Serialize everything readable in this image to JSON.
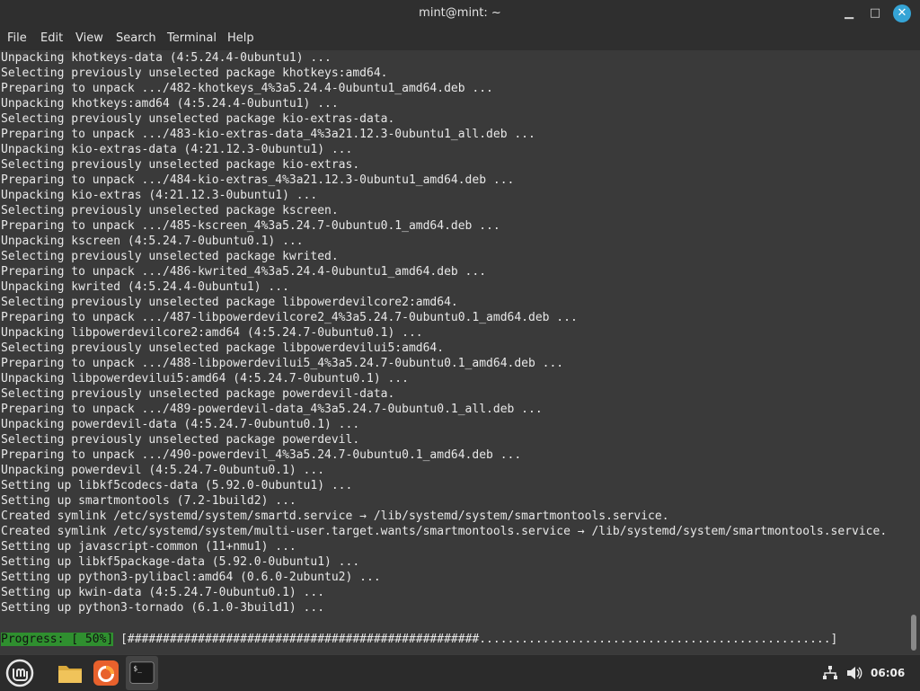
{
  "window": {
    "title": "mint@mint: ~"
  },
  "menu": [
    "File",
    "Edit",
    "View",
    "Search",
    "Terminal",
    "Help"
  ],
  "terminal": {
    "lines": [
      "Unpacking khotkeys-data (4:5.24.4-0ubuntu1) ...",
      "Selecting previously unselected package khotkeys:amd64.",
      "Preparing to unpack .../482-khotkeys_4%3a5.24.4-0ubuntu1_amd64.deb ...",
      "Unpacking khotkeys:amd64 (4:5.24.4-0ubuntu1) ...",
      "Selecting previously unselected package kio-extras-data.",
      "Preparing to unpack .../483-kio-extras-data_4%3a21.12.3-0ubuntu1_all.deb ...",
      "Unpacking kio-extras-data (4:21.12.3-0ubuntu1) ...",
      "Selecting previously unselected package kio-extras.",
      "Preparing to unpack .../484-kio-extras_4%3a21.12.3-0ubuntu1_amd64.deb ...",
      "Unpacking kio-extras (4:21.12.3-0ubuntu1) ...",
      "Selecting previously unselected package kscreen.",
      "Preparing to unpack .../485-kscreen_4%3a5.24.7-0ubuntu0.1_amd64.deb ...",
      "Unpacking kscreen (4:5.24.7-0ubuntu0.1) ...",
      "Selecting previously unselected package kwrited.",
      "Preparing to unpack .../486-kwrited_4%3a5.24.4-0ubuntu1_amd64.deb ...",
      "Unpacking kwrited (4:5.24.4-0ubuntu1) ...",
      "Selecting previously unselected package libpowerdevilcore2:amd64.",
      "Preparing to unpack .../487-libpowerdevilcore2_4%3a5.24.7-0ubuntu0.1_amd64.deb ...",
      "Unpacking libpowerdevilcore2:amd64 (4:5.24.7-0ubuntu0.1) ...",
      "Selecting previously unselected package libpowerdevilui5:amd64.",
      "Preparing to unpack .../488-libpowerdevilui5_4%3a5.24.7-0ubuntu0.1_amd64.deb ...",
      "Unpacking libpowerdevilui5:amd64 (4:5.24.7-0ubuntu0.1) ...",
      "Selecting previously unselected package powerdevil-data.",
      "Preparing to unpack .../489-powerdevil-data_4%3a5.24.7-0ubuntu0.1_all.deb ...",
      "Unpacking powerdevil-data (4:5.24.7-0ubuntu0.1) ...",
      "Selecting previously unselected package powerdevil.",
      "Preparing to unpack .../490-powerdevil_4%3a5.24.7-0ubuntu0.1_amd64.deb ...",
      "Unpacking powerdevil (4:5.24.7-0ubuntu0.1) ...",
      "Setting up libkf5codecs-data (5.92.0-0ubuntu1) ...",
      "Setting up smartmontools (7.2-1build2) ...",
      "Created symlink /etc/systemd/system/smartd.service → /lib/systemd/system/smartmontools.service.",
      "Created symlink /etc/systemd/system/multi-user.target.wants/smartmontools.service → /lib/systemd/system/smartmontools.service.",
      "Setting up javascript-common (11+nmu1) ...",
      "Setting up libkf5package-data (5.92.0-0ubuntu1) ...",
      "Setting up python3-pylibacl:amd64 (0.6.0-2ubuntu2) ...",
      "Setting up kwin-data (4:5.24.7-0ubuntu0.1) ...",
      "Setting up python3-tornado (6.1.0-3build1) ..."
    ],
    "progress": {
      "label": "Progress: [ 50%]",
      "bar": "[##################################################..................................................]",
      "percent": 50
    }
  },
  "taskbar": {
    "icons": [
      "mint-menu-icon",
      "files-folder-icon",
      "firefox-icon",
      "terminal-icon"
    ],
    "clock": "06:06"
  },
  "colors": {
    "progress_green": "#2f8f2f",
    "close_button_blue": "#35a4d6",
    "terminal_bg": "#3a3a3a"
  }
}
